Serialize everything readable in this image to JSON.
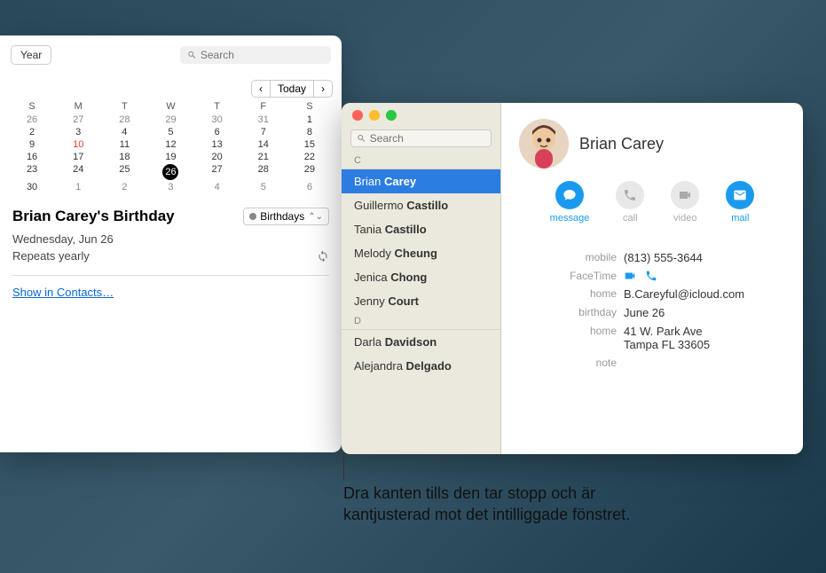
{
  "calendar": {
    "toolbar": {
      "view_year": "Year",
      "search_placeholder": "Search"
    },
    "nav": {
      "prev": "‹",
      "today": "Today",
      "next": "›"
    },
    "dow": [
      "S",
      "M",
      "T",
      "W",
      "T",
      "F",
      "S"
    ],
    "weeks": [
      [
        "26",
        "27",
        "28",
        "29",
        "30",
        "31",
        "1"
      ],
      [
        "2",
        "3",
        "4",
        "5",
        "6",
        "7",
        "8"
      ],
      [
        "9",
        "10",
        "11",
        "12",
        "13",
        "14",
        "15"
      ],
      [
        "16",
        "17",
        "18",
        "19",
        "20",
        "21",
        "22"
      ],
      [
        "23",
        "24",
        "25",
        "26",
        "27",
        "28",
        "29"
      ],
      [
        "30",
        "1",
        "2",
        "3",
        "4",
        "5",
        "6"
      ]
    ],
    "event": {
      "title": "Brian Carey's Birthday",
      "category": "Birthdays",
      "date": "Wednesday, Jun 26",
      "repeat": "Repeats yearly",
      "link": "Show in Contacts…"
    }
  },
  "contacts": {
    "search_placeholder": "Search",
    "sections": [
      {
        "letter": "C",
        "items": [
          {
            "first": "Brian",
            "last": "Carey",
            "selected": true
          },
          {
            "first": "Guillermo",
            "last": "Castillo"
          },
          {
            "first": "Tania",
            "last": "Castillo"
          },
          {
            "first": "Melody",
            "last": "Cheung"
          },
          {
            "first": "Jenica",
            "last": "Chong"
          },
          {
            "first": "Jenny",
            "last": "Court"
          }
        ]
      },
      {
        "letter": "D",
        "items": [
          {
            "first": "Darla",
            "last": "Davidson"
          },
          {
            "first": "Alejandra",
            "last": "Delgado"
          }
        ]
      }
    ],
    "detail": {
      "name": "Brian Carey",
      "actions": {
        "message": "message",
        "call": "call",
        "video": "video",
        "mail": "mail"
      },
      "fields": {
        "mobile_label": "mobile",
        "mobile": "(813) 555-3644",
        "facetime_label": "FaceTime",
        "home_email_label": "home",
        "home_email": "B.Careyful@icloud.com",
        "birthday_label": "birthday",
        "birthday": "June 26",
        "home_addr_label": "home",
        "home_addr_line1": "41 W. Park Ave",
        "home_addr_line2": "Tampa FL 33605",
        "note_label": "note"
      }
    }
  },
  "callout": "Dra kanten tills den tar stopp och är kantjusterad mot det intilliggade fönstret."
}
